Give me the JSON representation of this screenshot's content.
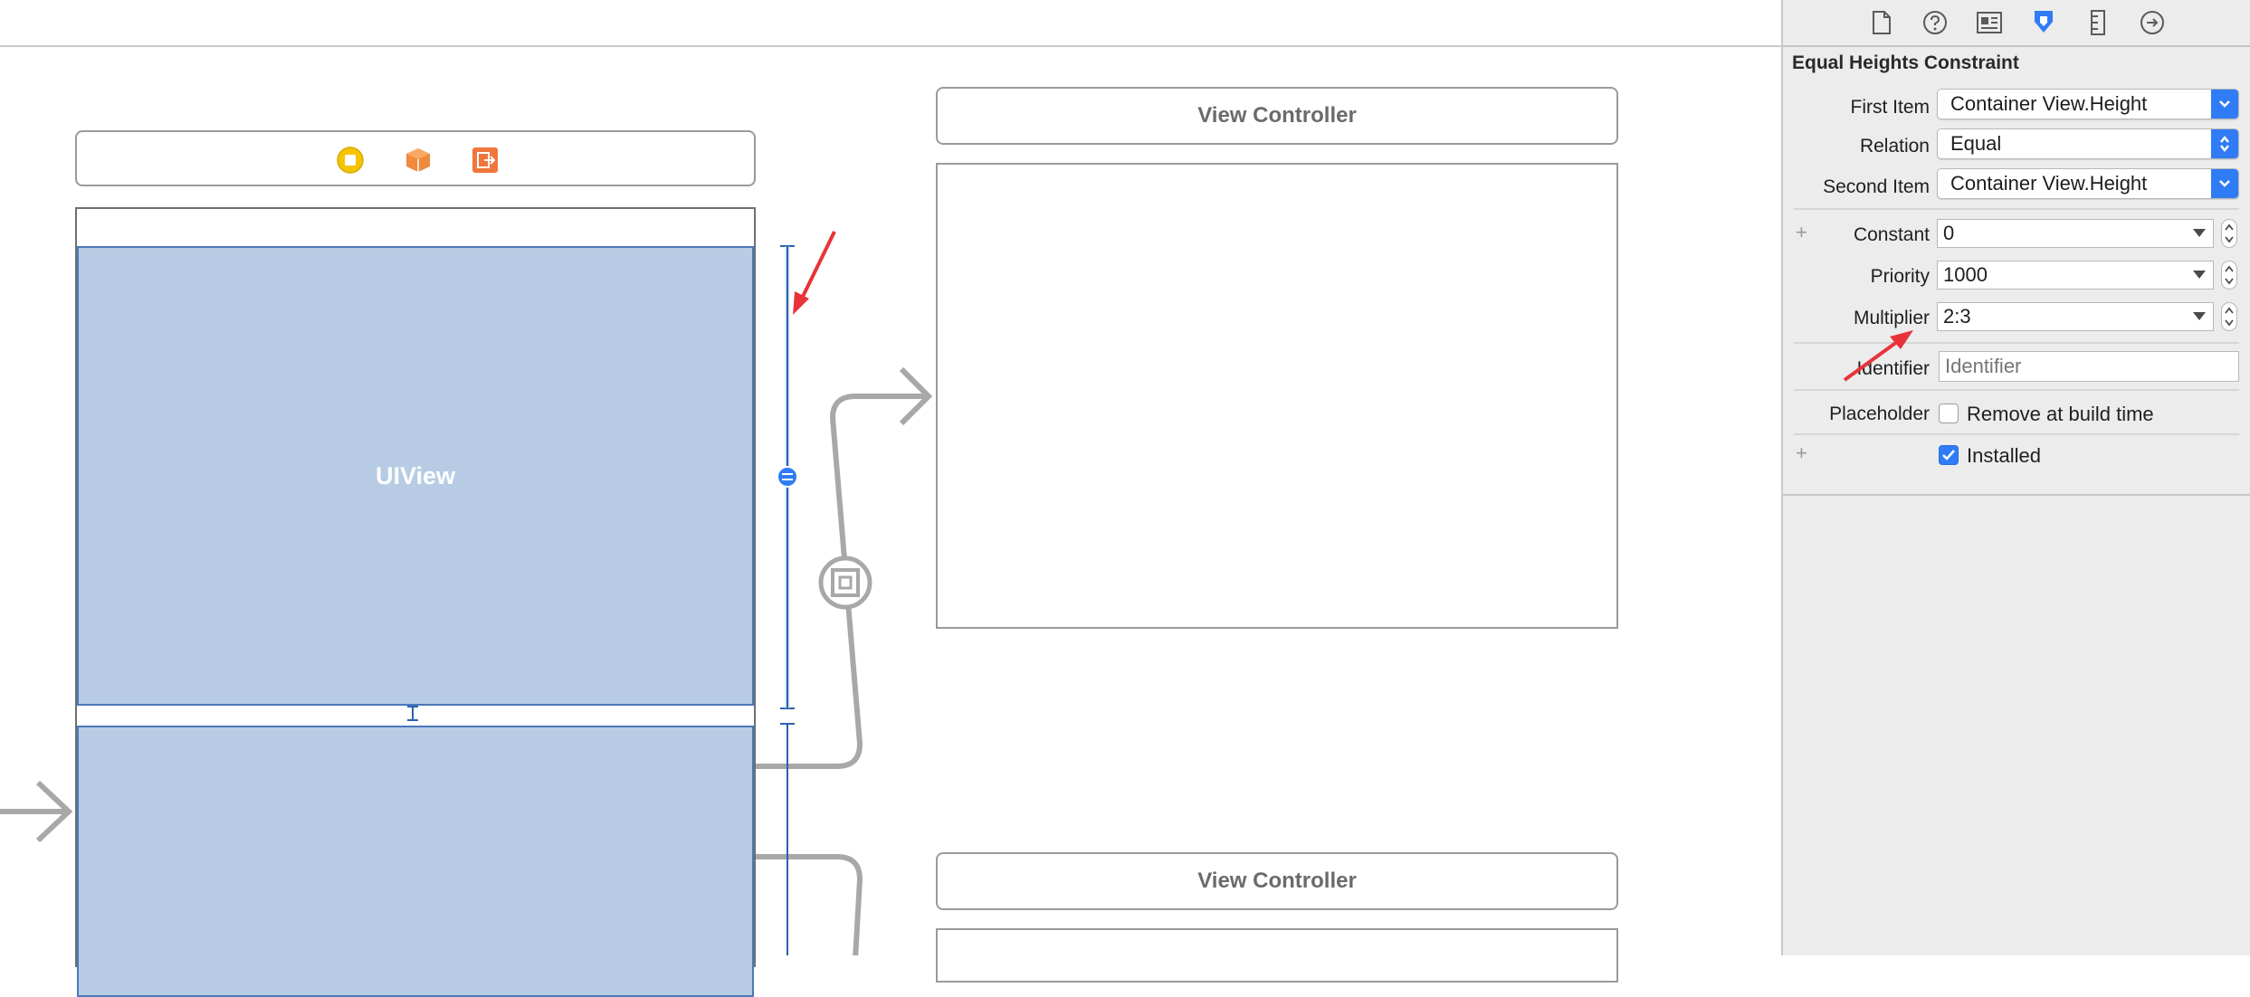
{
  "inspector": {
    "header": "Equal Heights Constraint",
    "toolbar_icons": [
      "file-icon",
      "help-icon",
      "identity-icon",
      "size-icon",
      "ruler-icon",
      "connections-icon"
    ],
    "rows": {
      "first_item": {
        "label": "First Item",
        "value": "Container View.Height"
      },
      "relation": {
        "label": "Relation",
        "value": "Equal"
      },
      "second_item": {
        "label": "Second Item",
        "value": "Container View.Height"
      },
      "constant": {
        "label": "Constant",
        "value": "0"
      },
      "priority": {
        "label": "Priority",
        "value": "1000"
      },
      "multiplier": {
        "label": "Multiplier",
        "value": "2:3"
      },
      "identifier": {
        "label": "Identifier",
        "placeholder": "Identifier"
      },
      "placeholder": {
        "label": "Placeholder",
        "checkbox_label": "Remove at build time",
        "checked": false
      },
      "installed": {
        "checkbox_label": "Installed",
        "checked": true
      }
    }
  },
  "canvas": {
    "uiview_label": "UIView",
    "view_controller_1": "View Controller",
    "view_controller_2": "View Controller"
  },
  "colors": {
    "accent": "#2f7cf6",
    "uiview_fill": "#b7cce4",
    "uiview_border": "#4b78b8",
    "annotation_arrow": "#e8333a",
    "segue_gray": "#a8a8a8"
  }
}
